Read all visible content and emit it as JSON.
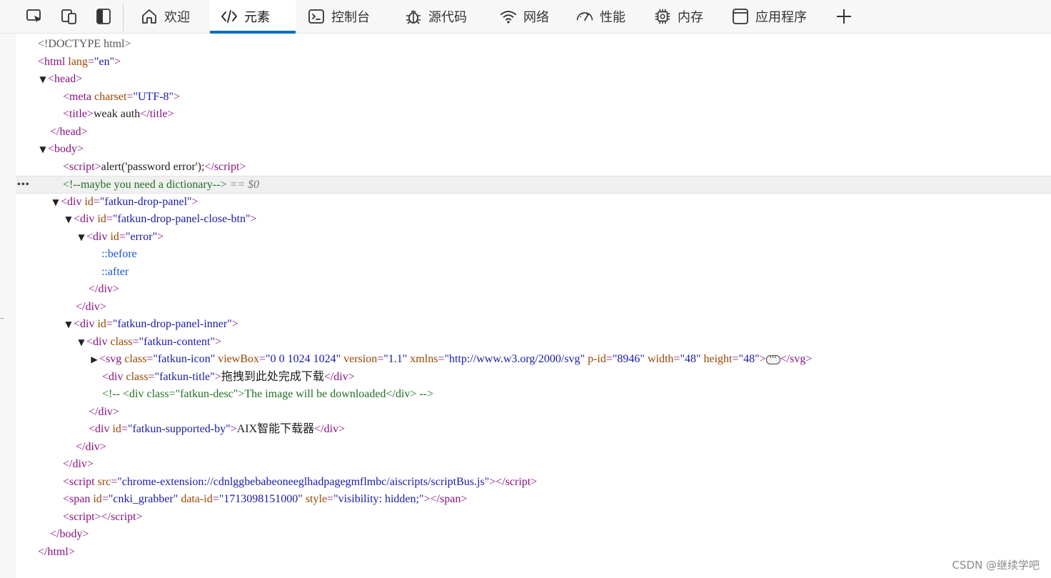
{
  "toolbar": {
    "tabs": [
      {
        "label": "欢迎",
        "icon": "home-icon"
      },
      {
        "label": "元素",
        "icon": "code-icon"
      },
      {
        "label": "控制台",
        "icon": "console-icon"
      },
      {
        "label": "源代码",
        "icon": "bug-icon"
      },
      {
        "label": "网络",
        "icon": "wifi-icon"
      },
      {
        "label": "性能",
        "icon": "gauge-icon"
      },
      {
        "label": "内存",
        "icon": "chip-icon"
      },
      {
        "label": "应用程序",
        "icon": "app-window-icon"
      }
    ],
    "active_tab": "元素",
    "add_tab_icon": "plus-icon"
  },
  "colors": {
    "accent": "#0f6cbd",
    "tag": "#881280",
    "attribute_name": "#994500",
    "attribute_value": "#1a1aa6",
    "comment": "#236e25",
    "pseudo": "#1a56c8"
  },
  "dom": {
    "doctype": "<!DOCTYPE html>",
    "html_open": "html",
    "html_lang_attr": "lang",
    "html_lang_val": "\"en\"",
    "head": "head",
    "meta": "meta",
    "meta_charset_attr": "charset",
    "meta_charset_val": "\"UTF-8\"",
    "title": "title",
    "title_text": "weak auth",
    "body": "body",
    "script": "script",
    "script_text": "alert('password error');",
    "comment_dictionary": "<!--maybe you need a dictionary-->",
    "selected_marker": "== $0",
    "div": "div",
    "id_attr": "id",
    "class_attr": "class",
    "panel_id": "\"fatkun-drop-panel\"",
    "close_btn_id": "\"fatkun-drop-panel-close-btn\"",
    "error_id": "\"error\"",
    "before": "::before",
    "after": "::after",
    "inner_id": "\"fatkun-drop-panel-inner\"",
    "content_class": "\"fatkun-content\"",
    "svg": "svg",
    "svg_class": "\"fatkun-icon\"",
    "svg_viewbox_attr": "viewBox",
    "svg_viewbox": "\"0 0 1024 1024\"",
    "svg_version_attr": "version",
    "svg_version": "\"1.1\"",
    "svg_xmlns_attr": "xmlns",
    "svg_xmlns": "\"http://www.w3.org/2000/svg\"",
    "svg_pid_attr": "p-id",
    "svg_pid": "\"8946\"",
    "svg_width_attr": "width",
    "svg_width": "\"48\"",
    "svg_height_attr": "height",
    "svg_height": "\"48\"",
    "title_class": "\"fatkun-title\"",
    "title_div_text": "拖拽到此处完成下载",
    "desc_comment": "<!-- <div class=\"fatkun-desc\">The image will be downloaded</div>  -->",
    "supported_id": "\"fatkun-supported-by\"",
    "supported_text": "AIX智能下载器",
    "script_src_attr": "src",
    "script_src": "\"chrome-extension://cdnlggbebabeoneeglhadpagegmflmbc/aiscripts/scriptBus.js\"",
    "span": "span",
    "span_id": "\"cnki_grabber\"",
    "span_dataid_attr": "data-id",
    "span_dataid": "\"1713098151000\"",
    "span_style_attr": "style",
    "span_style": "\"visibility: hidden;\""
  },
  "watermark": "CSDN @继续学吧"
}
